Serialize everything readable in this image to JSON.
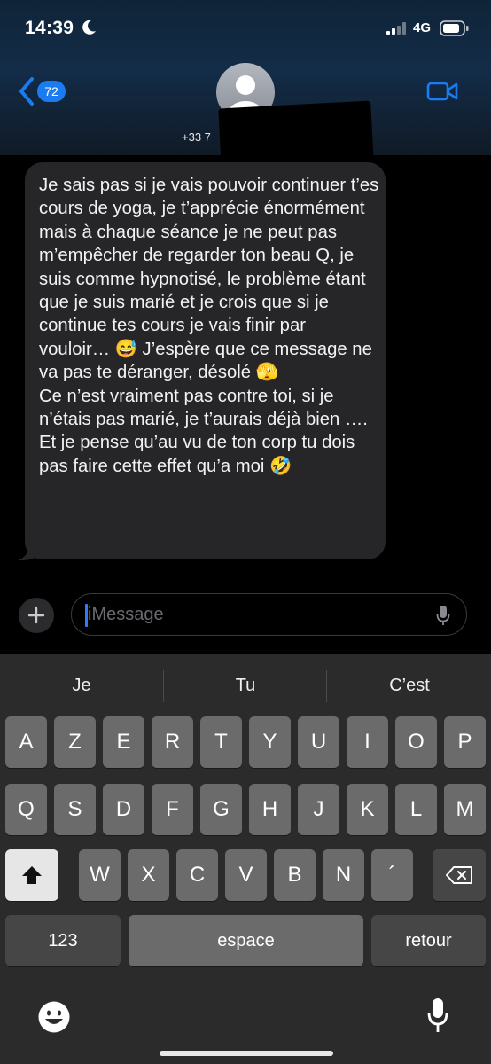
{
  "status_bar": {
    "time": "14:39",
    "network": "4G"
  },
  "header": {
    "back_badge": "72",
    "contact_number": "+33 7"
  },
  "message": {
    "text": "Je sais pas si je vais pouvoir continuer t’es cours de yoga, je t’apprécie énormément mais à chaque séance je ne peut pas m’empêcher de regarder ton beau Q, je suis comme hypnotisé, le problème étant que je suis marié et je crois que si je continue tes cours je vais finir par vouloir… 😅 J’espère que ce message ne va pas te déranger, désolé 🫣\nCe n’est vraiment pas contre toi, si je n’étais pas marié, je t’aurais déjà bien …. Et je pense qu’au vu de ton corp tu dois pas faire cette effet qu’a moi 🤣"
  },
  "compose": {
    "placeholder": "iMessage"
  },
  "keyboard": {
    "suggestions": [
      "Je",
      "Tu",
      "C’est"
    ],
    "row1": [
      "A",
      "Z",
      "E",
      "R",
      "T",
      "Y",
      "U",
      "I",
      "O",
      "P"
    ],
    "row2": [
      "Q",
      "S",
      "D",
      "F",
      "G",
      "H",
      "J",
      "K",
      "L",
      "M"
    ],
    "row3": [
      "W",
      "X",
      "C",
      "V",
      "B",
      "N",
      "´"
    ],
    "numbers_label": "123",
    "space_label": "espace",
    "return_label": "retour"
  },
  "colors": {
    "accent": "#1a7cf0",
    "bubble": "#262629",
    "keyboard_bg": "#2b2b2b",
    "key": "#6b6b6b"
  }
}
